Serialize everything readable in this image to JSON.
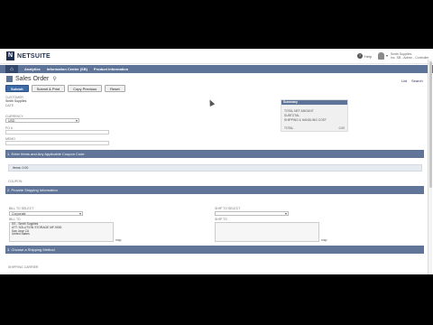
{
  "header": {
    "logo_mark": "N",
    "logo_text": "NETSUITE",
    "help_label": "Help",
    "user_line1": "Smith Supplies",
    "user_line2": "Inc. SB - Admin - Controller"
  },
  "nav": {
    "items": [
      "Analytics",
      "Information Center (SB)",
      "Product Information"
    ]
  },
  "page": {
    "title": "Sales Order",
    "list_link": "List",
    "search_link": "Search"
  },
  "buttons": {
    "submit": "Submit",
    "submit_print": "Submit & Print",
    "copy_previous": "Copy Previous",
    "reset": "Reset"
  },
  "form": {
    "customer_label": "CUSTOMER",
    "customer_value": "Smith Supplies",
    "date_label": "DATE",
    "currency_label": "CURRENCY",
    "currency_value": "USD",
    "po_label": "PO #",
    "memo_label": "MEMO"
  },
  "summary": {
    "title": "Summary",
    "rows": [
      {
        "label": "TOTAL NET AMOUNT",
        "value": ""
      },
      {
        "label": "SUBTOTAL",
        "value": ""
      },
      {
        "label": "SHIPPING & HANDLING COST",
        "value": ""
      },
      {
        "label": "TOTAL",
        "value": "0.00"
      }
    ]
  },
  "sections": {
    "items_title": "1. Enter Items and Any Applicable Coupon Code",
    "items_summary": "Items: 0.00",
    "coupon_label": "COUPON",
    "billing_title": "2. Provide Shipping Information",
    "bill_to_select_label": "BILL TO SELECT",
    "bill_to_select_value": "Corporate",
    "ship_to_select_label": "SHIP TO SELECT",
    "bill_to_label": "BILL TO",
    "bill_to_lines": [
      "SS - Smith Supplies",
      "ATT: SOLUTION STORAGE MF-9000",
      "San Jose CA",
      "United States"
    ],
    "ship_to_label": "SHIP TO",
    "map_label": "map",
    "shipping_method_title": "3. Choose a Shipping Method",
    "shipping_carrier_label": "SHIPPING CARRIER"
  }
}
